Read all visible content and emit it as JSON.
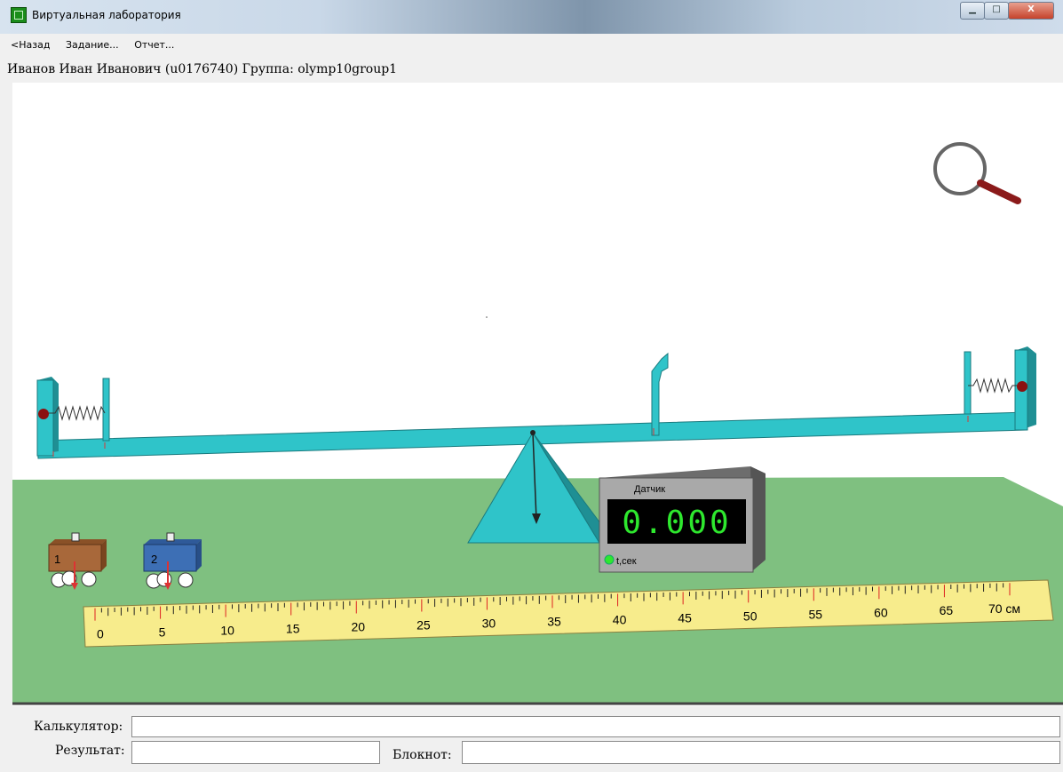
{
  "window": {
    "title": "Виртуальная лаборатория"
  },
  "menu": {
    "back": "<Назад",
    "task": "Задание...",
    "report": "Отчет..."
  },
  "user": {
    "info": "Иванов Иван Иванович (u0176740)  Группа: olymp10group1"
  },
  "sensor": {
    "title": "Датчик",
    "value": "0.000",
    "unit_label": "t,сек"
  },
  "carts": [
    {
      "label": "1",
      "color": "#a8683a"
    },
    {
      "label": "2",
      "color": "#3d6fb5"
    }
  ],
  "ruler": {
    "labels": [
      "0",
      "5",
      "10",
      "15",
      "20",
      "25",
      "30",
      "35",
      "40",
      "45",
      "50",
      "55",
      "60",
      "65",
      "70 см"
    ]
  },
  "bottom": {
    "calculator_label": "Калькулятор:",
    "result_label": "Результат:",
    "notebook_label": "Блокнот:",
    "calculator_value": "",
    "result_value": "",
    "notebook_value": ""
  },
  "colors": {
    "beam": "#2fc4c9",
    "table": "#7fc080",
    "ruler": "#f7ec8c",
    "display_digits": "#2ee82e"
  },
  "icons": {
    "zoom": "magnifier-icon"
  }
}
